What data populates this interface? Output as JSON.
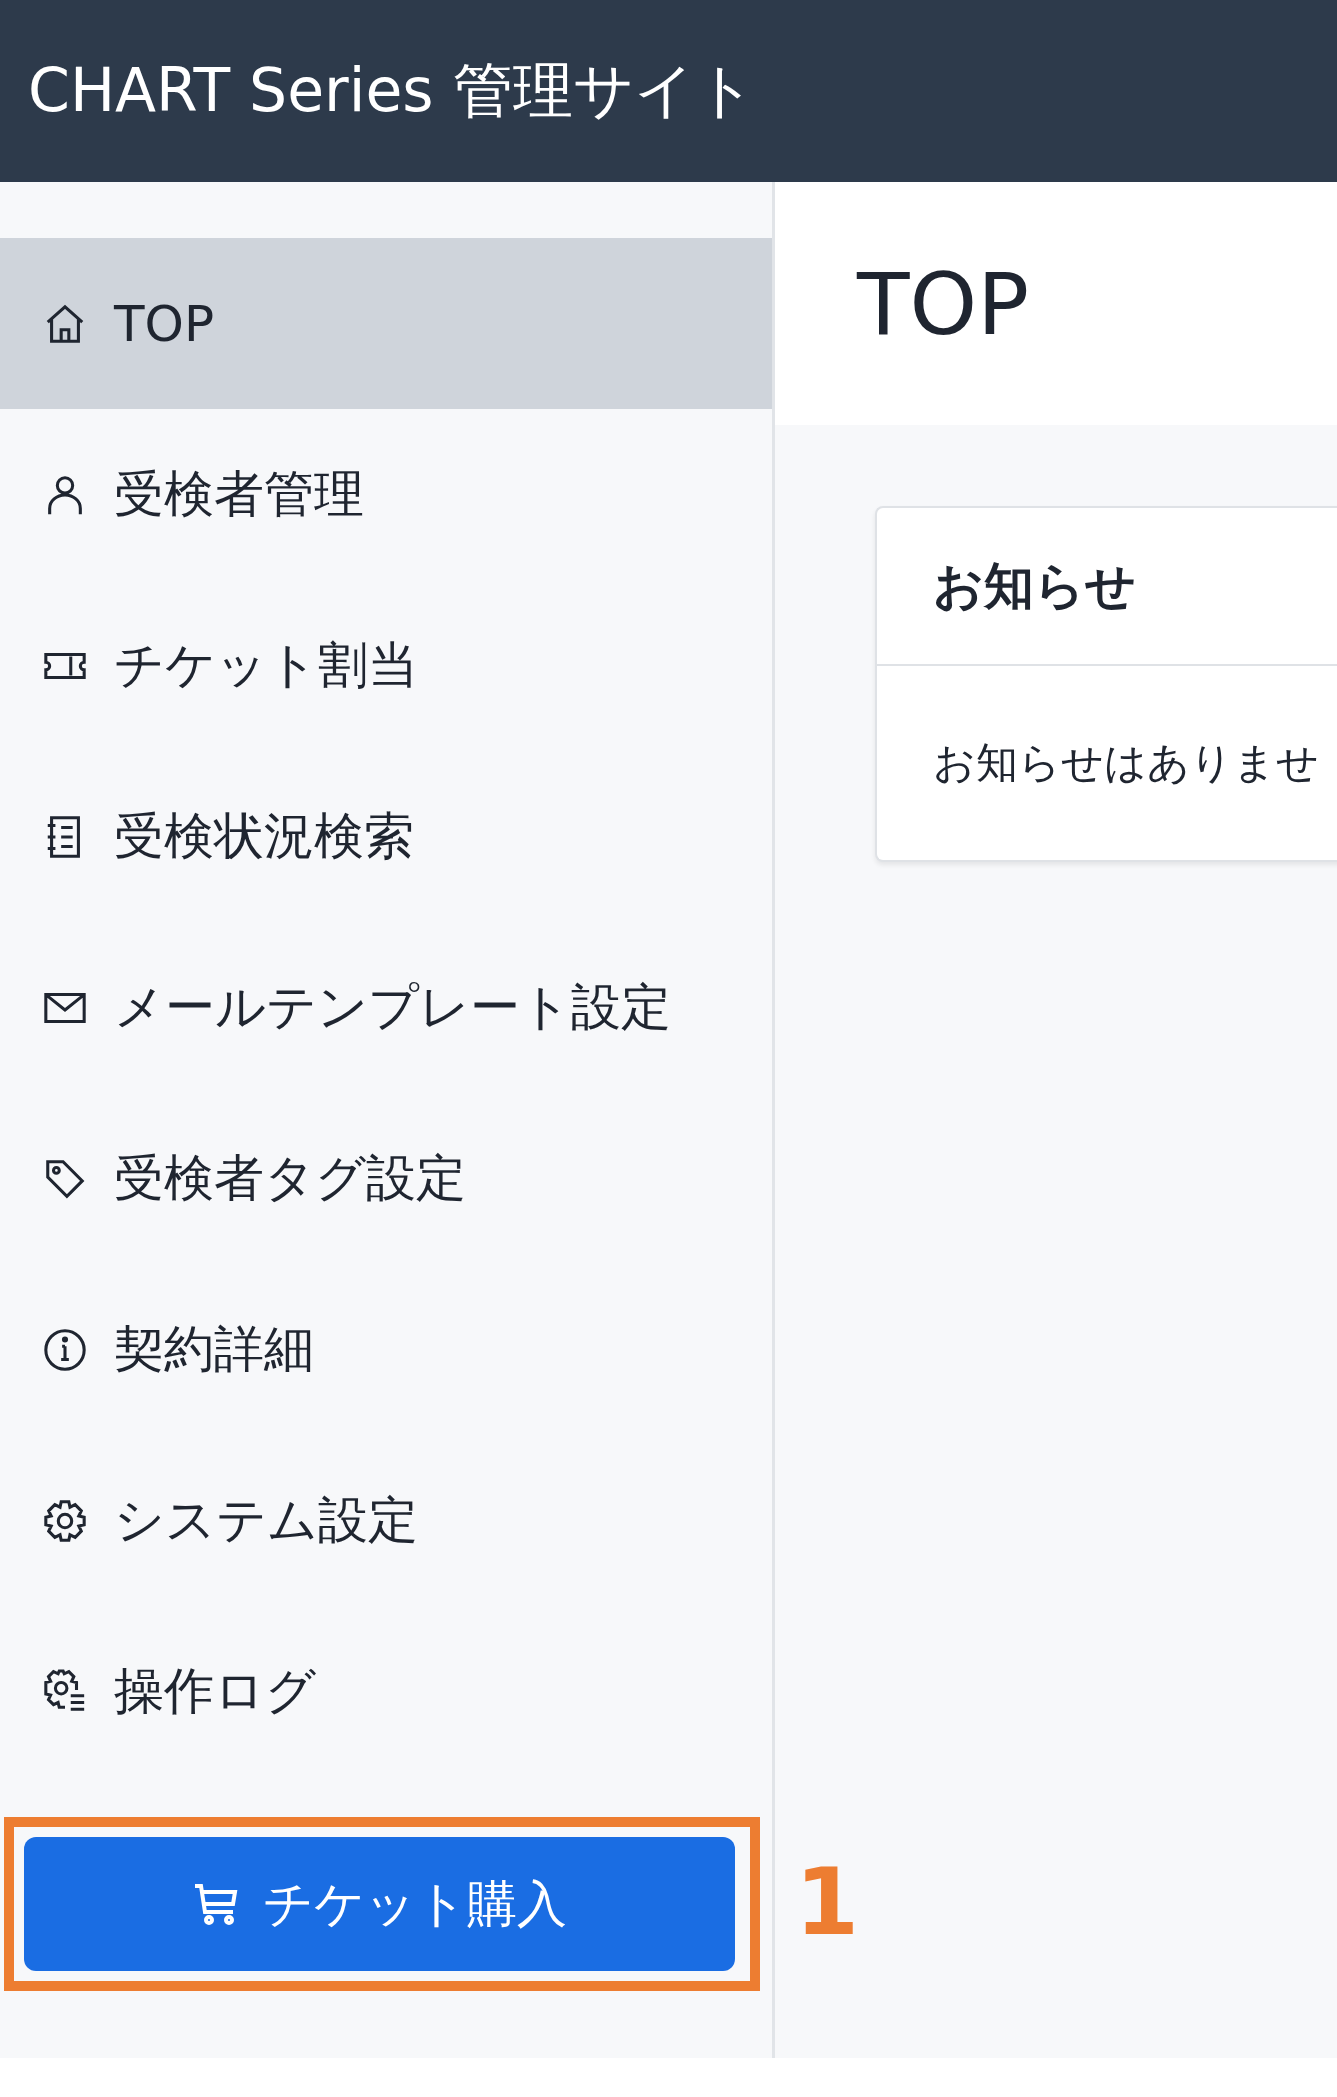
{
  "header": {
    "title": "CHART Series 管理サイト"
  },
  "sidebar": {
    "items": [
      {
        "label": "TOP",
        "selected": true
      },
      {
        "label": "受検者管理",
        "selected": false
      },
      {
        "label": "チケット割当",
        "selected": false
      },
      {
        "label": "受検状況検索",
        "selected": false
      },
      {
        "label": "メールテンプレート設定",
        "selected": false
      },
      {
        "label": "受検者タグ設定",
        "selected": false
      },
      {
        "label": "契約詳細",
        "selected": false
      },
      {
        "label": "システム設定",
        "selected": false
      },
      {
        "label": "操作ログ",
        "selected": false
      }
    ],
    "purchase_button": {
      "label": "チケット購入"
    }
  },
  "page": {
    "title": "TOP"
  },
  "notice_card": {
    "title": "お知らせ",
    "message": "お知らせはありませ"
  },
  "annotation": {
    "number": "1"
  }
}
